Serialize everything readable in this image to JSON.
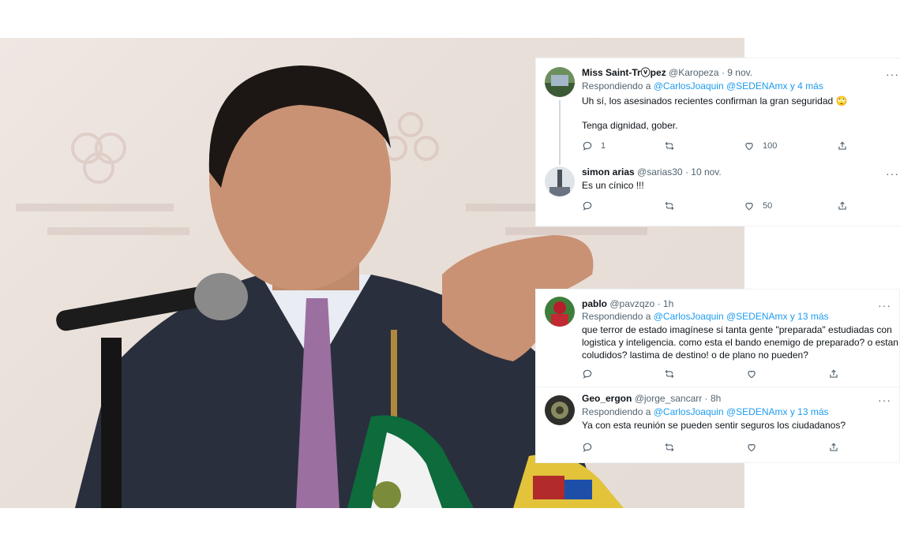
{
  "thread_a": {
    "tweets": [
      {
        "name": "Miss Saint-Trⓥpez",
        "handle": "@Karopeza",
        "date": "9 nov.",
        "reply_prefix": "Respondiendo a ",
        "reply_mentions": "@CarlosJoaquin @SEDENAmx y 4 más",
        "text_line1": "Uh sí, los asesinados recientes confirman la gran seguridad 🙄",
        "text_line2": "Tenga dignidad, gober.",
        "replies": "1",
        "retweets": "",
        "likes": "100"
      },
      {
        "name": "simon arias",
        "handle": "@sarias30",
        "date": "10 nov.",
        "text_line1": "Es un cínico !!!",
        "replies": "",
        "retweets": "",
        "likes": "50"
      }
    ]
  },
  "thread_b": {
    "tweets": [
      {
        "name": "pablo",
        "handle": "@pavzqzo",
        "date": "1h",
        "reply_prefix": "Respondiendo a ",
        "reply_mentions": "@CarlosJoaquin @SEDENAmx y 13 más",
        "text_line1": "que terror de estado imagínese si tanta gente \"preparada\" estudiadas con",
        "text_line2": "logistica y inteligencia. como esta el bando enemigo de preparado? o estan",
        "text_line3": "coludidos? lastima de destino! o de plano no pueden?"
      },
      {
        "name": "Geo_ergon",
        "handle": "@jorge_sancarr",
        "date": "8h",
        "reply_prefix": "Respondiendo a ",
        "reply_mentions": "@CarlosJoaquin @SEDENAmx y 13 más",
        "text_line1": "Ya con esta reunión se pueden sentir seguros los ciudadanos?"
      }
    ]
  },
  "icons": {
    "reply": "reply-icon",
    "retweet": "retweet-icon",
    "like": "heart-icon",
    "share": "share-icon",
    "more": "more-options-icon"
  },
  "colors": {
    "link": "#1d9bf0",
    "secondary_text": "#536471",
    "primary_text": "#0f1419",
    "border": "#eff3f4"
  }
}
